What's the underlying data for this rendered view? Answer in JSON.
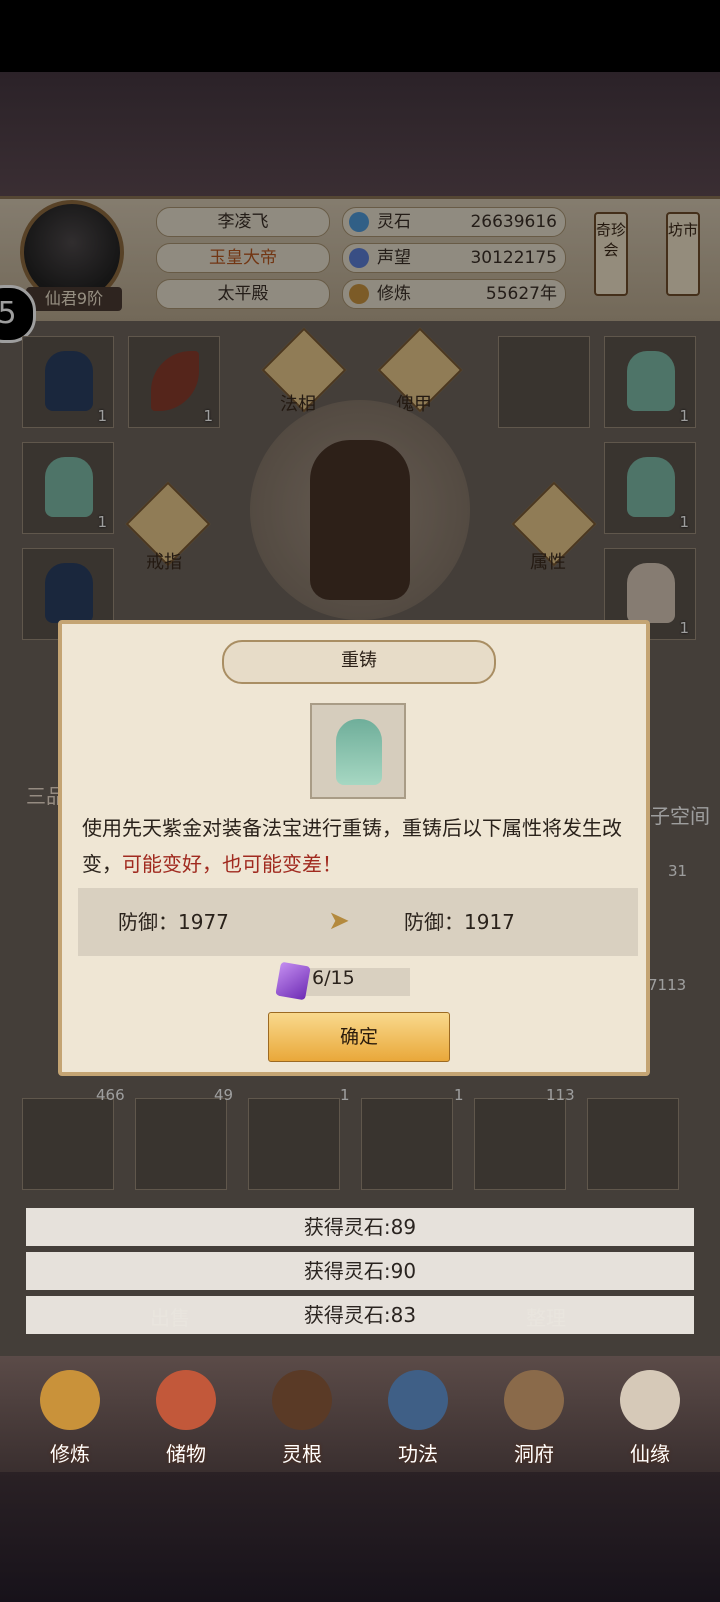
{
  "player": {
    "rank": "仙君9阶",
    "name": "李凌飞",
    "title": "玉皇大帝",
    "palace": "太平殿"
  },
  "stats": [
    {
      "icon": "spirit-stone-icon",
      "label": "灵石",
      "value": "26639616"
    },
    {
      "icon": "prestige-icon",
      "label": "声望",
      "value": "30122175"
    },
    {
      "icon": "cultivation-icon",
      "label": "修炼",
      "value": "55627年"
    }
  ],
  "side_buttons": {
    "treasure": "奇珍会",
    "market": "坊市"
  },
  "equip_labels": {
    "faxiang": "法相",
    "kuijia": "傀甲",
    "ring": "戒指",
    "attribute": "属性"
  },
  "slots": {
    "top": [
      "1",
      "1",
      "1"
    ],
    "left": [
      "1",
      "1"
    ],
    "right": [
      "1",
      "1",
      "1"
    ]
  },
  "background_text": {
    "tab_left": "三品",
    "space": "子空间",
    "sell": "出售",
    "sort": "整理"
  },
  "bag_counts": [
    "466",
    "49",
    "1",
    "1",
    "113",
    "31",
    "7113"
  ],
  "modal": {
    "title": "重铸",
    "desc_main": "使用先天紫金对装备法宝进行重铸，重铸后以下属性将发生改变，",
    "desc_warning": "可能变好，也可能变差！",
    "attr_before": "防御：1977",
    "attr_after": "防御：1917",
    "cost": "6/15",
    "confirm": "确定"
  },
  "toasts": [
    "获得灵石:89",
    "获得灵石:90",
    "获得灵石:83"
  ],
  "nav": [
    "修炼",
    "储物",
    "灵根",
    "功法",
    "洞府",
    "仙缘"
  ],
  "overlay_number": "5",
  "colors": {
    "accent_gold": "#e9a83a",
    "warning_red": "#a02a1f"
  }
}
